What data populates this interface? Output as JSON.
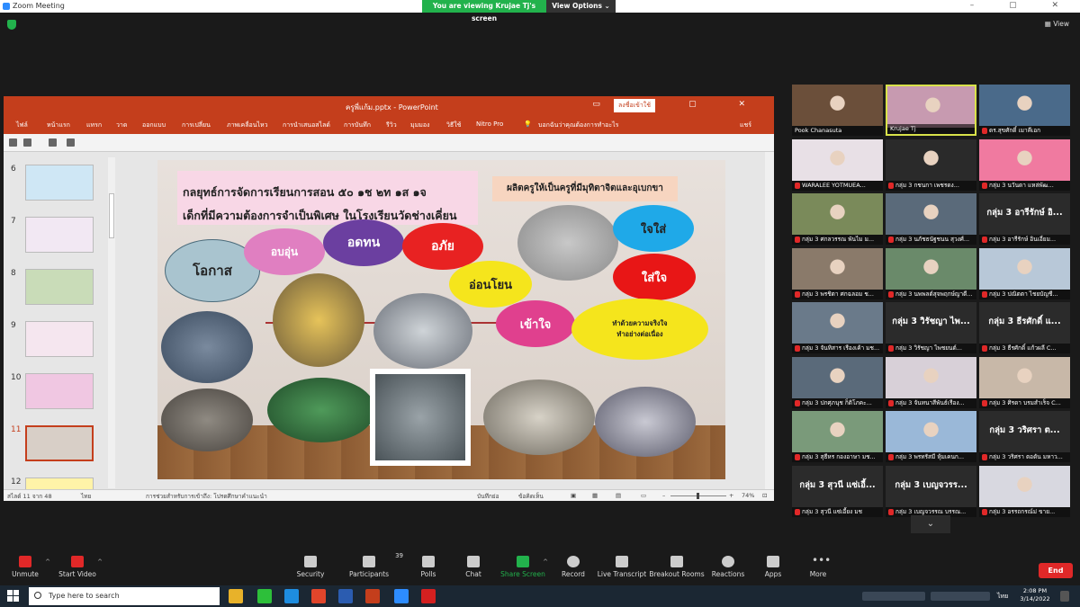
{
  "window": {
    "title": "Zoom Meeting",
    "banner": "You are viewing Krujae Tj's screen",
    "view_options": "View Options ⌄",
    "view_label": "View",
    "controls": "–  ▢  ✕"
  },
  "ppt": {
    "filename": "ครูพี่แก้ม.pptx  -  PowerPoint",
    "signin": "ลงชื่อเข้าใช้",
    "win_controls": "▭ – ▢ ✕",
    "ribbon_tabs": [
      "ไฟล์",
      "หน้าแรก",
      "แทรก",
      "วาด",
      "ออกแบบ",
      "การเปลี่ยน",
      "ภาพเคลื่อนไหว",
      "การนำเสนอสไลด์",
      "การบันทึก",
      "รีวิว",
      "มุมมอง",
      "วิธีใช้",
      "Nitro Pro",
      "บอกฉันว่าคุณต้องการทำอะไร",
      "แชร์"
    ],
    "thumb_numbers": [
      "6",
      "7",
      "8",
      "9",
      "10",
      "11",
      "12"
    ],
    "status": {
      "slide_info": "สไลด์ 11 จาก 48",
      "lang": "ไทย",
      "accessibility": "การช่วยสำหรับการเข้าถึง: โปรดศึกษาคำแนะนำ",
      "notes": "บันทึกย่อ",
      "comments": "ข้อคิดเห็น",
      "zoom": "74%"
    },
    "slide": {
      "title_line1": "กลยุทธ์การจัดการเรียนการสอน ๕๐ ๑ช ๒ท ๑ส ๑จ",
      "title_line2": "เด็กที่มีความต้องการจำเป็นพิเศษ ในโรงเรียนวัดช่างเคี่ยน",
      "right_title": "ผลิตครูให้เป็นครูที่มีมุทิตาจิตและอุเบกขา",
      "ovals": {
        "o1": "โอกาส",
        "o2": "อบอุ่น",
        "o3": "อดทน",
        "o4": "อภัย",
        "o5": "อ่อนโยน",
        "o6": "เข้าใจ",
        "o7": "ใจใส่",
        "o8": "ใส่ใจ",
        "o9a": "ทำด้วยความจริงใจ",
        "o9b": "ทำอย่างต่อเนื่อง"
      }
    }
  },
  "gallery": [
    {
      "name": "Pook Chanasuta",
      "big": "",
      "mute": false
    },
    {
      "name": "Krujae Tj",
      "big": "",
      "mute": false,
      "active": true
    },
    {
      "name": "ดร.สุขศักดิ์ เมาคีเอก",
      "big": "",
      "mute": true
    },
    {
      "name": "WARALEE YOTMUEA...",
      "big": "",
      "mute": true
    },
    {
      "name": "กลุ่ม 3 กชนกา เพชรดง...",
      "big": "",
      "mute": true
    },
    {
      "name": "กลุ่ม 3 นวันดา แหล่พัฒ...",
      "big": "",
      "mute": true
    },
    {
      "name": "กลุ่ม 3 ศกลวรรณ พันไม ม...",
      "big": "",
      "mute": true
    },
    {
      "name": "กลุ่ม 3 นภัชธนัฐชนน สุวงศ์...",
      "big": "",
      "mute": true
    },
    {
      "name": "กลุ่ม 3 อารีรักษ์ อินเอี่ยม...",
      "big": "กลุ่ม 3 อารีรักษ์ อิ...",
      "mute": true
    },
    {
      "name": "กลุ่ม 3 พรชิตา ศกฉลอม ช...",
      "big": "",
      "mute": true
    },
    {
      "name": "กลุ่ม 3 นพพลต์สุจพฤกษ์ญาดี...",
      "big": "",
      "mute": true
    },
    {
      "name": "กลุ่ม 3 ปณิตตา ไชยบัญชี...",
      "big": "",
      "mute": true
    },
    {
      "name": "กลุ่ม 3 จันทิสาร เรืองเค้า มช...",
      "big": "",
      "mute": true
    },
    {
      "name": "กลุ่ม 3 วิรัชญา ไพชยนต์...",
      "big": "กลุ่ม 3 วิรัชญา ไพ...",
      "mute": true
    },
    {
      "name": "กลุ่ม 3 ธีรศักดิ์ แก้วผลี C...",
      "big": "กลุ่ม 3 ธีรศักดิ์ แ...",
      "mute": true
    },
    {
      "name": "กลุ่ม 3 ปกศุภนุช ก็ติโภคะ...",
      "big": "",
      "mute": true
    },
    {
      "name": "กลุ่ม 3 จันทนาสีพันธ์เรือง...",
      "big": "",
      "mute": true
    },
    {
      "name": "กลุ่ม 3 ศิรดา บรมสำเร็จ C...",
      "big": "",
      "mute": true
    },
    {
      "name": "กลุ่ม 3 สุธีหร กองอาษา มช...",
      "big": "",
      "mute": true
    },
    {
      "name": "กลุ่ม 3 พรทรัสมี หุ้มเคนก...",
      "big": "",
      "mute": true
    },
    {
      "name": "กลุ่ม 3 วริศรา ตอดัน มหาว...",
      "big": "กลุ่ม 3 วริศรา ต...",
      "mute": true
    },
    {
      "name": "กลุ่ม 3 สุวนี แซ่เอี้ยง มช",
      "big": "กลุ่ม 3 สุวนี แซ่เอี้...",
      "mute": true
    },
    {
      "name": "กลุ่ม 3 เบญจวรรณ บรรณ...",
      "big": "กลุ่ม 3 เบญจวรร...",
      "mute": true
    },
    {
      "name": "กลุ่ม 3 อรรถกรณ์ม่ ขาย...",
      "big": "",
      "mute": true
    }
  ],
  "toolbar": {
    "unmute": "Unmute",
    "start_video": "Start Video",
    "security": "Security",
    "participants": "Participants",
    "participants_count": "39",
    "polls": "Polls",
    "chat": "Chat",
    "share": "Share Screen",
    "record": "Record",
    "transcript": "Live Transcript",
    "breakout": "Breakout Rooms",
    "reactions": "Reactions",
    "apps": "Apps",
    "more": "More",
    "end": "End"
  },
  "taskbar": {
    "search_placeholder": "Type here to search",
    "lang": "ไทย",
    "time": "2:08 PM",
    "date": "3/14/2022"
  },
  "colors": {
    "zoom_green": "#22b24c",
    "ppt_red": "#c43e1c",
    "end_red": "#e02828",
    "active_speaker": "#d8e24a"
  }
}
